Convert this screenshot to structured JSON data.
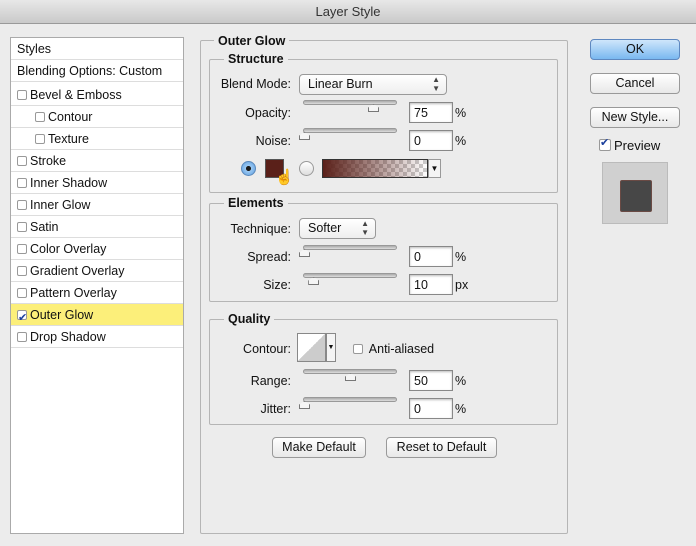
{
  "window": {
    "title": "Layer Style"
  },
  "sidebar": {
    "header": "Styles",
    "blending": "Blending Options: Custom",
    "items": [
      {
        "label": "Bevel & Emboss",
        "checked": false,
        "indent": false
      },
      {
        "label": "Contour",
        "checked": false,
        "indent": true
      },
      {
        "label": "Texture",
        "checked": false,
        "indent": true
      },
      {
        "label": "Stroke",
        "checked": false,
        "indent": false
      },
      {
        "label": "Inner Shadow",
        "checked": false,
        "indent": false
      },
      {
        "label": "Inner Glow",
        "checked": false,
        "indent": false
      },
      {
        "label": "Satin",
        "checked": false,
        "indent": false
      },
      {
        "label": "Color Overlay",
        "checked": false,
        "indent": false
      },
      {
        "label": "Gradient Overlay",
        "checked": false,
        "indent": false
      },
      {
        "label": "Pattern Overlay",
        "checked": false,
        "indent": false
      },
      {
        "label": "Outer Glow",
        "checked": true,
        "indent": false,
        "selected": true
      },
      {
        "label": "Drop Shadow",
        "checked": false,
        "indent": false
      }
    ]
  },
  "panel": {
    "title": "Outer Glow",
    "structure": {
      "title": "Structure",
      "blend_label": "Blend Mode:",
      "blend_value": "Linear Burn",
      "opacity_label": "Opacity:",
      "opacity": "75",
      "noise_label": "Noise:",
      "noise": "0",
      "unit": "%",
      "glow_color": "#5a2019"
    },
    "elements": {
      "title": "Elements",
      "technique_label": "Technique:",
      "technique": "Softer",
      "spread_label": "Spread:",
      "spread": "0",
      "spread_unit": "%",
      "size_label": "Size:",
      "size": "10",
      "size_unit": "px"
    },
    "quality": {
      "title": "Quality",
      "contour_label": "Contour:",
      "anti_aliased": "Anti-aliased",
      "range_label": "Range:",
      "range": "50",
      "jitter_label": "Jitter:",
      "jitter": "0",
      "unit": "%"
    },
    "make_default": "Make Default",
    "reset_default": "Reset to Default"
  },
  "actions": {
    "ok": "OK",
    "cancel": "Cancel",
    "new_style": "New Style...",
    "preview": "Preview"
  }
}
